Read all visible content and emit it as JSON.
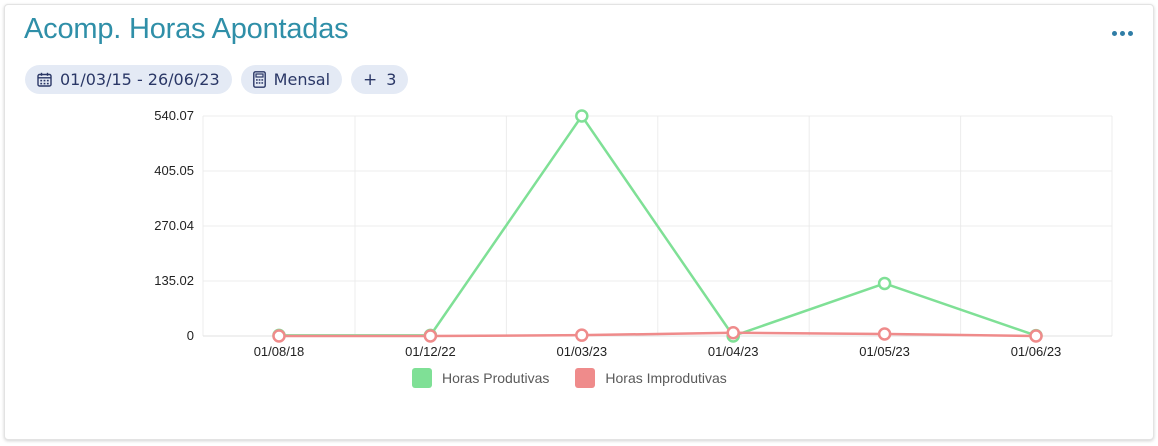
{
  "title": "Acomp. Horas Apontadas",
  "filters": {
    "date_range": "01/03/15 - 26/06/23",
    "period": "Mensal",
    "more": "3"
  },
  "icons": {
    "menu": "more-dots-icon",
    "date": "calendar-icon",
    "period": "calculator-icon",
    "more": "plus-icon"
  },
  "chart_data": {
    "type": "line",
    "categories": [
      "01/08/18",
      "01/12/22",
      "01/03/23",
      "01/04/23",
      "01/05/23",
      "01/06/23"
    ],
    "yticks": [
      "540.07",
      "405.05",
      "270.04",
      "135.02",
      "0"
    ],
    "ylim": [
      0,
      540.07
    ],
    "grid": true,
    "legend_position": "bottom",
    "series": [
      {
        "name": "Horas Produtivas",
        "color": "#7fe096",
        "values": [
          1.5,
          1.5,
          540.07,
          0,
          129,
          1
        ]
      },
      {
        "name": "Horas Improdutivas",
        "color": "#ef8b8b",
        "values": [
          0,
          0,
          2,
          8,
          5,
          0
        ]
      }
    ]
  }
}
